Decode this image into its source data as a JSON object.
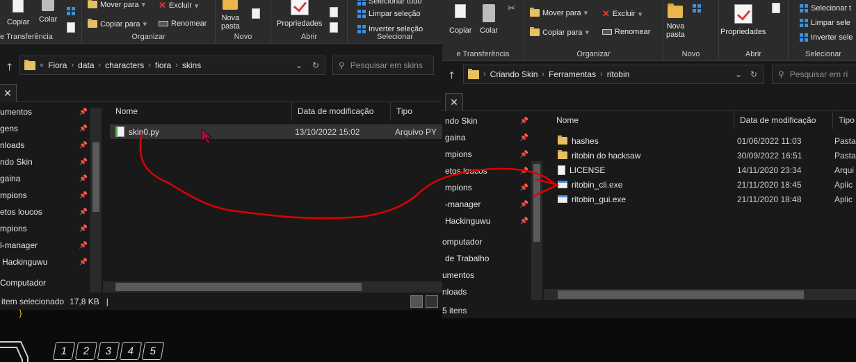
{
  "left": {
    "ribbon": {
      "copy": "Copiar",
      "paste_group_prefix": "Colar",
      "move_to": "Mover para",
      "copy_to": "Copiar para",
      "delete": "Excluir",
      "rename": "Renomear",
      "new_folder": "Nova\npasta",
      "properties": "Propriedades",
      "select_all": "Selecionar tudo",
      "clear_selection": "Limpar seleção",
      "invert_selection": "Inverter seleção",
      "group_clipboard": "e Transferência",
      "group_organize": "Organizar",
      "group_new": "Novo",
      "group_open": "Abrir",
      "group_select": "Selecionar"
    },
    "breadcrumb": [
      "Fiora",
      "data",
      "characters",
      "fiora",
      "skins"
    ],
    "search_placeholder": "Pesquisar em skins",
    "nav_items": [
      "umentos",
      "gens",
      "nloads",
      "ndo Skin",
      "gaina",
      "mpions",
      "etos loucos",
      "mpions",
      "l-manager",
      "Hackinguwu",
      "Computador"
    ],
    "columns": [
      "Nome",
      "Data de modificação",
      "Tipo"
    ],
    "files": [
      {
        "name": "skin0.py",
        "date": "13/10/2022 15:02",
        "type": "Arquivo PY",
        "selected": true
      }
    ],
    "status_selected": "item selecionado",
    "status_size": "17,8 KB"
  },
  "right": {
    "ribbon": {
      "copy": "Copiar",
      "paste": "Colar",
      "move_to": "Mover para",
      "copy_to": "Copiar para",
      "delete": "Excluir",
      "rename": "Renomear",
      "new_folder": "Nova\npasta",
      "properties": "Propriedades",
      "select_all": "Selecionar t",
      "clear_selection": "Limpar sele",
      "invert_selection": "Inverter sele",
      "group_clipboard": "e Transferência",
      "group_organize": "Organizar",
      "group_new": "Novo",
      "group_open": "Abrir",
      "group_select": "Selecionar"
    },
    "breadcrumb": [
      "Criando Skin",
      "Ferramentas",
      "ritobin"
    ],
    "search_placeholder": "Pesquisar em ri",
    "nav_items": [
      "ndo Skin",
      "gaina",
      "mpions",
      "etos loucos",
      "mpions",
      "-manager",
      "Hackinguwu",
      "omputador",
      "de Trabalho",
      "umentos",
      "nloads"
    ],
    "columns": [
      "Nome",
      "Data de modificação",
      "Tipo"
    ],
    "files": [
      {
        "name": "hashes",
        "date": "01/06/2022 11:03",
        "type": "Pasta",
        "icon": "folder-icon"
      },
      {
        "name": "ritobin do hacksaw",
        "date": "30/09/2022 16:51",
        "type": "Pasta",
        "icon": "folder-icon"
      },
      {
        "name": "LICENSE",
        "date": "14/11/2020 23:34",
        "type": "Arqui",
        "icon": "document-icon"
      },
      {
        "name": "ritobin_cli.exe",
        "date": "21/11/2020 18:45",
        "type": "Aplic",
        "icon": "exe-icon"
      },
      {
        "name": "ritobin_gui.exe",
        "date": "21/11/2020 18:48",
        "type": "Aplic",
        "icon": "exe-icon"
      }
    ],
    "status_items": "5 itens"
  },
  "keys": [
    "1",
    "2",
    "3",
    "4",
    "5"
  ],
  "annotation_color": "#e00000",
  "accent_folder": "#e8b64a"
}
